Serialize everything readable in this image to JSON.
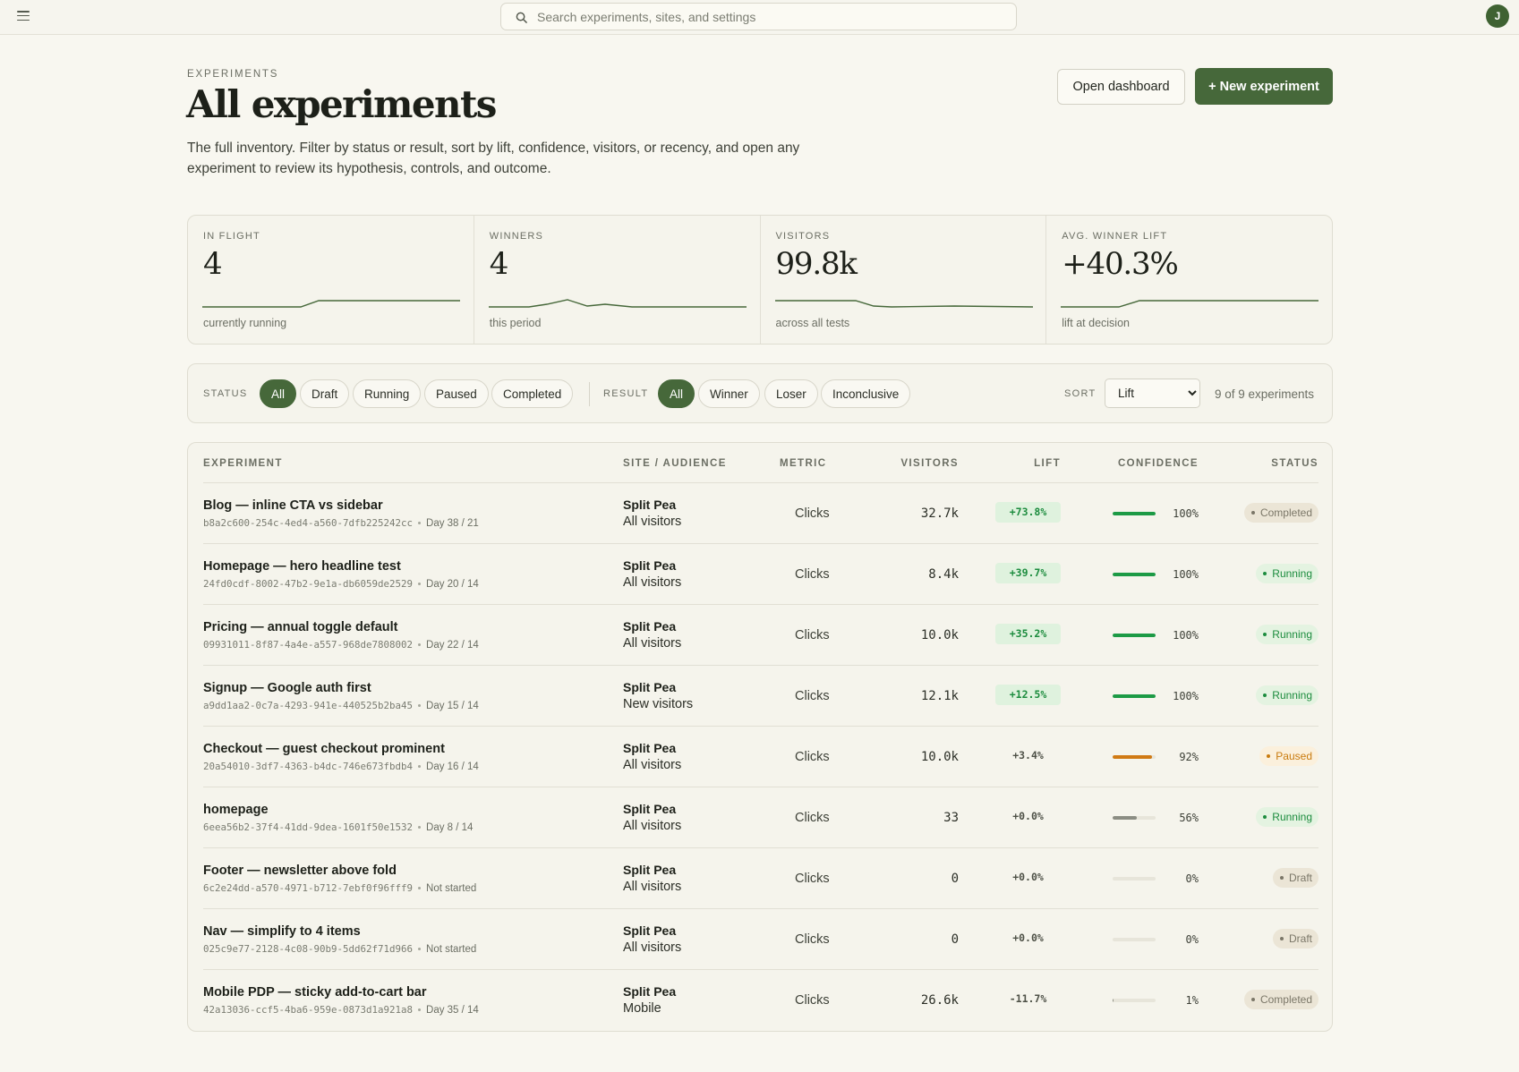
{
  "search": {
    "placeholder": "Search experiments, sites, and settings"
  },
  "user": {
    "initial": "J"
  },
  "header": {
    "eyebrow": "EXPERIMENTS",
    "title": "All experiments",
    "description": "The full inventory. Filter by status or result, sort by lift, confidence, visitors, or recency, and open any experiment to review its hypothesis, controls, and outcome.",
    "open_dashboard_label": "Open dashboard",
    "new_experiment_label": "+ New experiment"
  },
  "stats": [
    {
      "label": "IN FLIGHT",
      "value": "4",
      "sub": "currently running"
    },
    {
      "label": "WINNERS",
      "value": "4",
      "sub": "this period"
    },
    {
      "label": "VISITORS",
      "value": "99.8k",
      "sub": "across all tests"
    },
    {
      "label": "AVG. WINNER LIFT",
      "value": "+40.3%",
      "sub": "lift at decision"
    }
  ],
  "filters": {
    "status_label": "STATUS",
    "status_options": [
      "All",
      "Draft",
      "Running",
      "Paused",
      "Completed"
    ],
    "status_selected": "All",
    "result_label": "RESULT",
    "result_options": [
      "All",
      "Winner",
      "Loser",
      "Inconclusive"
    ],
    "result_selected": "All",
    "sort_label": "SORT",
    "sort_value": "Lift",
    "count_text": "9 of 9 experiments"
  },
  "table": {
    "headers": {
      "experiment": "EXPERIMENT",
      "site": "SITE / AUDIENCE",
      "metric": "METRIC",
      "visitors": "VISITORS",
      "lift": "LIFT",
      "confidence": "CONFIDENCE",
      "status": "STATUS"
    },
    "rows": [
      {
        "name": "Blog — inline CTA vs sidebar",
        "id": "b8a2c600-254c-4ed4-a560-7dfb225242cc",
        "progress": "Day 38 / 21",
        "site": "Split Pea",
        "audience": "All visitors",
        "metric": "Clicks",
        "visitors": "32.7k",
        "lift": "+73.8%",
        "lift_positive": true,
        "confidence": 100,
        "confidence_label": "100%",
        "status": "Completed"
      },
      {
        "name": "Homepage — hero headline test",
        "id": "24fd0cdf-8002-47b2-9e1a-db6059de2529",
        "progress": "Day 20 / 14",
        "site": "Split Pea",
        "audience": "All visitors",
        "metric": "Clicks",
        "visitors": "8.4k",
        "lift": "+39.7%",
        "lift_positive": true,
        "confidence": 100,
        "confidence_label": "100%",
        "status": "Running"
      },
      {
        "name": "Pricing — annual toggle default",
        "id": "09931011-8f87-4a4e-a557-968de7808002",
        "progress": "Day 22 / 14",
        "site": "Split Pea",
        "audience": "All visitors",
        "metric": "Clicks",
        "visitors": "10.0k",
        "lift": "+35.2%",
        "lift_positive": true,
        "confidence": 100,
        "confidence_label": "100%",
        "status": "Running"
      },
      {
        "name": "Signup — Google auth first",
        "id": "a9dd1aa2-0c7a-4293-941e-440525b2ba45",
        "progress": "Day 15 / 14",
        "site": "Split Pea",
        "audience": "New visitors",
        "metric": "Clicks",
        "visitors": "12.1k",
        "lift": "+12.5%",
        "lift_positive": true,
        "confidence": 100,
        "confidence_label": "100%",
        "status": "Running"
      },
      {
        "name": "Checkout — guest checkout prominent",
        "id": "20a54010-3df7-4363-b4dc-746e673fbdb4",
        "progress": "Day 16 / 14",
        "site": "Split Pea",
        "audience": "All visitors",
        "metric": "Clicks",
        "visitors": "10.0k",
        "lift": "+3.4%",
        "lift_positive": false,
        "confidence": 92,
        "confidence_label": "92%",
        "status": "Paused"
      },
      {
        "name": "homepage",
        "id": "6eea56b2-37f4-41dd-9dea-1601f50e1532",
        "progress": "Day 8 / 14",
        "site": "Split Pea",
        "audience": "All visitors",
        "metric": "Clicks",
        "visitors": "33",
        "lift": "+0.0%",
        "lift_positive": false,
        "confidence": 56,
        "confidence_label": "56%",
        "status": "Running"
      },
      {
        "name": "Footer — newsletter above fold",
        "id": "6c2e24dd-a570-4971-b712-7ebf0f96fff9",
        "progress": "Not started",
        "site": "Split Pea",
        "audience": "All visitors",
        "metric": "Clicks",
        "visitors": "0",
        "lift": "+0.0%",
        "lift_positive": false,
        "confidence": 0,
        "confidence_label": "0%",
        "status": "Draft"
      },
      {
        "name": "Nav — simplify to 4 items",
        "id": "025c9e77-2128-4c08-90b9-5dd62f71d966",
        "progress": "Not started",
        "site": "Split Pea",
        "audience": "All visitors",
        "metric": "Clicks",
        "visitors": "0",
        "lift": "+0.0%",
        "lift_positive": false,
        "confidence": 0,
        "confidence_label": "0%",
        "status": "Draft"
      },
      {
        "name": "Mobile PDP — sticky add-to-cart bar",
        "id": "42a13036-ccf5-4ba6-959e-0873d1a921a8",
        "progress": "Day 35 / 14",
        "site": "Split Pea",
        "audience": "Mobile",
        "metric": "Clicks",
        "visitors": "26.6k",
        "lift": "-11.7%",
        "lift_positive": false,
        "confidence": 1,
        "confidence_label": "1%",
        "status": "Completed"
      }
    ]
  },
  "colors": {
    "accent": "#46683a",
    "positive": "#1c8c3e",
    "warning": "#c97b0e",
    "neutral": "#7b7768"
  }
}
